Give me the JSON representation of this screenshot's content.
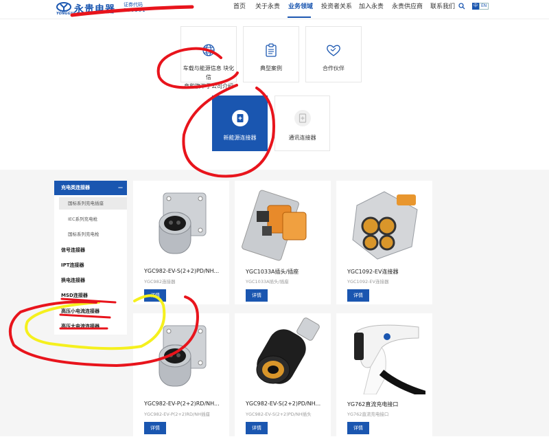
{
  "header": {
    "logo_sub": "YONGGUI",
    "logo_name": "永贵电器",
    "stock_label": "证券代码",
    "stock_code": "300351",
    "nav": [
      "首页",
      "关于永贵",
      "业务领域",
      "投资者关系",
      "加入永贵",
      "永贵供应商",
      "联系我们"
    ],
    "active_nav": "业务领域",
    "lang_cn": "中",
    "lang_en": "EN"
  },
  "top_cards": [
    {
      "label_line1": "车载与能源信息",
      "label_line2": "块化信",
      "label_line3": "息和旗下子公司介绍",
      "icon": "globe-icon"
    },
    {
      "label": "典型案例",
      "icon": "clipboard-icon"
    },
    {
      "label": "合作伙伴",
      "icon": "handshake-heart-icon"
    }
  ],
  "sub_cards": [
    {
      "label": "新能源连接器",
      "icon": "plus-document-icon",
      "selected": true
    },
    {
      "label": "通讯连接器",
      "icon": "plus-document-icon",
      "selected": false
    }
  ],
  "sidebar": {
    "head": "充电类连接器",
    "toggle": "—",
    "subitems": [
      "国标系列充电插座",
      "IEC系列充电枪",
      "国标系列充电枪"
    ],
    "items": [
      "信号连接器",
      "IPT连接器",
      "换电连接器",
      "MSD连接器",
      "高压小电流连接器",
      "高压大电流连接器"
    ]
  },
  "products": [
    {
      "name": "YGC982-EV-S(2+2)PD/NH...",
      "sub": "YGC982连接器",
      "btn": "详情"
    },
    {
      "name": "YGC1033A插头/插座",
      "sub": "YGC1033A插头/插座",
      "btn": "详情"
    },
    {
      "name": "YGC1092-EV连接器",
      "sub": "YGC1092-EV连接器",
      "btn": "详情"
    },
    {
      "name": "YGC982-EV-P(2+2)RD/NH...",
      "sub": "YGC982-EV-P(2+2)RD/NH插座",
      "btn": "详情"
    },
    {
      "name": "YGC982-EV-S(2+2)PD/NH...",
      "sub": "YGC982-EV-S(2+2)PD/NH插头",
      "btn": "详情"
    },
    {
      "name": "YG762直流充电接口",
      "sub": "YG762直流充电接口",
      "btn": "详情"
    }
  ],
  "colors": {
    "brand": "#1a56b0",
    "annotation_red": "#e8141c",
    "annotation_yellow": "#f5f01e"
  }
}
